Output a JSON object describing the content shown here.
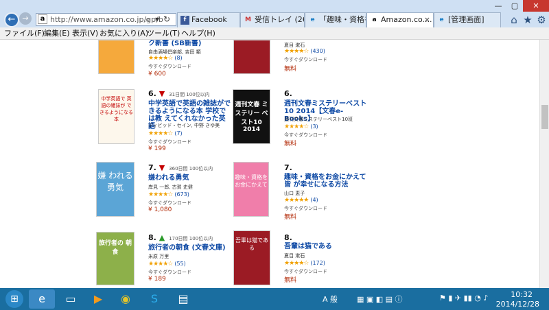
{
  "browser": {
    "url": "http://www.amazon.co.jp/gp/b",
    "tabs": [
      {
        "label": "Facebook",
        "icon": "f"
      },
      {
        "label": "受信トレイ (26...",
        "icon": "M"
      },
      {
        "label": "「趣味・資格を...",
        "icon": "e"
      },
      {
        "label": "Amazon.co....",
        "icon": "a",
        "active": true
      },
      {
        "label": "[管理画面]",
        "icon": "e"
      }
    ]
  },
  "menubar": [
    "ファイル(F)",
    "編集(E)",
    "表示(V)",
    "お気に入り(A)",
    "ツール(T)",
    "ヘルプ(H)"
  ],
  "books": [
    {
      "rank": "",
      "title": "ク新書 (SB新書)",
      "author": "自由酒場倶楽部, 吉田 類",
      "reviews": "(8)",
      "stars": "★★★★☆",
      "download": "今すぐダウンロード",
      "price": "¥ 600",
      "cover_text": "",
      "cover_bg": "#f5a93c",
      "cover_fg": "#fff"
    },
    {
      "rank": "",
      "title": "",
      "author": "夏目 漱石",
      "reviews": "(430)",
      "stars": "★★★★☆",
      "download": "今すぐダウンロード",
      "price": "無料",
      "cover_text": "",
      "cover_bg": "#9b1b24",
      "cover_fg": "#fff"
    },
    {
      "rank": "6.",
      "trend": "▼",
      "trend_text": "31日間 100位以内",
      "title": "中学英語で英語の雑誌がで きるようになる本 学校では教 えてくれなかった英語",
      "author": "ディビッド・セイン, 中野 きゆ美",
      "reviews": "(7)",
      "stars": "★★★★☆",
      "download": "今すぐダウンロード",
      "price": "¥ 199",
      "cover_text": "中学英語で 英語の雑誌が できるようになる本",
      "cover_bg": "#fdf7ec",
      "cover_fg": "#c20000"
    },
    {
      "rank": "6.",
      "title": "週刊文春ミステリーベスト10 2014【文春e-Books】",
      "author": "週刊文春ミステリーベスト10班",
      "reviews": "(3)",
      "stars": "★★★★☆",
      "download": "今すぐダウンロード",
      "price": "無料",
      "cover_text": "週刊文春 ミステリー ベスト10 2014",
      "cover_bg": "#111111",
      "cover_fg": "#ffffff"
    },
    {
      "rank": "7.",
      "trend": "▼",
      "trend_text": "360日間 100位以内",
      "title": "嫌われる勇気",
      "author": "岸見 一郎, 古賀 史健",
      "reviews": "(673)",
      "stars": "★★★★☆",
      "download": "今すぐダウンロード",
      "price": "¥ 1,080",
      "cover_text": "嫌 われる 勇気",
      "cover_bg": "#5ba5d6",
      "cover_fg": "#ffffff"
    },
    {
      "rank": "7.",
      "title": "趣味・資格をお金にかえて皆 が幸せになる方法",
      "author": "山口 恵子",
      "reviews": "(4)",
      "stars": "★★★★★",
      "download": "今すぐダウンロード",
      "price": "無料",
      "cover_text": "趣味・資格を お金にかえて",
      "cover_bg": "#f07eaa",
      "cover_fg": "#ffffff"
    },
    {
      "rank": "8.",
      "trend": "▲",
      "trend_text": "170日間 100位以内",
      "title": "旅行者の朝食 (文春文庫)",
      "author": "米原 万里",
      "reviews": "(55)",
      "stars": "★★★★☆",
      "download": "今すぐダウンロード",
      "price": "¥ 189",
      "cover_text": "旅行者の 朝食",
      "cover_bg": "#8db04a",
      "cover_fg": "#ffffff"
    },
    {
      "rank": "8.",
      "title": "吾輩は猫である",
      "author": "夏目 漱石",
      "reviews": "(172)",
      "stars": "★★★★☆",
      "download": "今すぐダウンロード",
      "price": "無料",
      "cover_text": "吾輩は猫である",
      "cover_bg": "#9b1b24",
      "cover_fg": "#ffffff"
    }
  ],
  "taskbar": {
    "ime": "A 般",
    "time": "10:32",
    "date": "2014/12/28"
  }
}
